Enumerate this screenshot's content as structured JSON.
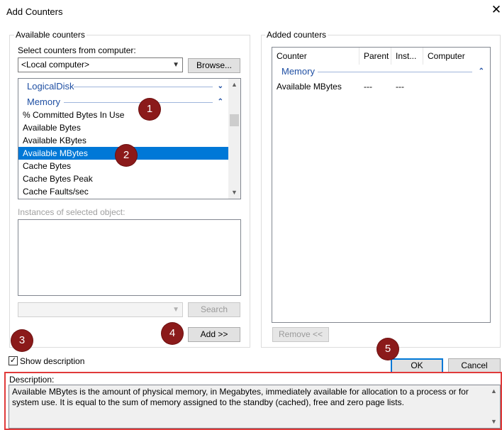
{
  "window": {
    "title": "Add Counters",
    "close_glyph": "✕"
  },
  "available": {
    "group_label": "Available counters",
    "select_computer_label": "Select counters from computer:",
    "computer_value": "<Local computer>",
    "browse_label": "Browse...",
    "list": {
      "group_logicaldisk": "LogicalDisk",
      "group_memory": "Memory",
      "items": [
        "% Committed Bytes In Use",
        "Available Bytes",
        "Available KBytes",
        "Available MBytes",
        "Cache Bytes",
        "Cache Bytes Peak",
        "Cache Faults/sec"
      ],
      "selected_index": 3
    },
    "instances_label": "Instances of selected object:",
    "search_label": "Search",
    "add_label": "Add >>"
  },
  "added": {
    "group_label": "Added counters",
    "columns": [
      "Counter",
      "Parent",
      "Inst...",
      "Computer"
    ],
    "group_memory": "Memory",
    "rows": [
      {
        "counter": "Available MBytes",
        "parent": "---",
        "instance": "---",
        "computer": ""
      }
    ],
    "remove_label": "Remove <<"
  },
  "show_description": {
    "label": "Show description",
    "checked": true
  },
  "buttons": {
    "ok_label": "OK",
    "cancel_label": "Cancel"
  },
  "description": {
    "label": "Description:",
    "text": "Available MBytes is the amount of physical memory, in Megabytes, immediately available for allocation to a process or for system use. It is equal to the sum of memory assigned to the standby (cached), free and zero page lists."
  },
  "badges": [
    "1",
    "2",
    "3",
    "4",
    "5"
  ],
  "colors": {
    "accent": "#0078d7",
    "badge": "#8b1a1a",
    "highlight_border": "#e03a3a",
    "group_text": "#1f4fa3"
  }
}
